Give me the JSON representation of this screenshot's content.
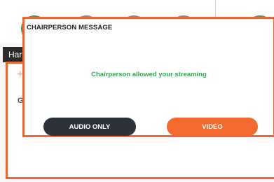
{
  "background": {
    "header_label": "Har",
    "plus_glyph": "+",
    "side_letter": "G"
  },
  "modal": {
    "title": "CHAIRPERSON MESSAGE",
    "message": "Chairperson allowed your streaming",
    "buttons": {
      "audio_only": "AUDIO ONLY",
      "video": "VIDEO"
    }
  },
  "colors": {
    "accent_orange": "#f26a2e",
    "border_orange": "#e8673a",
    "success_green": "#34a853",
    "dark_button": "#2d3139"
  }
}
